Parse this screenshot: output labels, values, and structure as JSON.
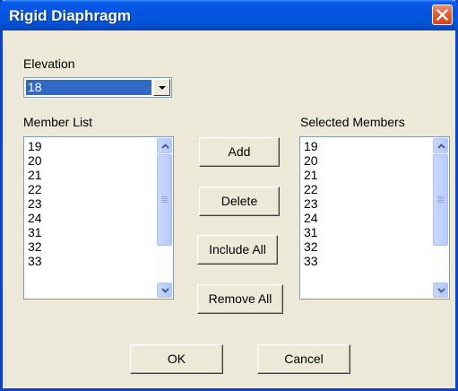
{
  "window": {
    "title": "Rigid Diaphragm"
  },
  "elevation": {
    "label": "Elevation",
    "selected_value": "18"
  },
  "member_list": {
    "label": "Member List",
    "items": [
      "19",
      "20",
      "21",
      "22",
      "23",
      "24",
      "31",
      "32",
      "33"
    ]
  },
  "selected_members": {
    "label": "Selected Members",
    "items": [
      "19",
      "20",
      "21",
      "22",
      "23",
      "24",
      "31",
      "32",
      "33"
    ]
  },
  "actions": {
    "add": "Add",
    "delete": "Delete",
    "include_all": "Include All",
    "remove_all": "Remove All"
  },
  "dialog_buttons": {
    "ok": "OK",
    "cancel": "Cancel"
  },
  "colors": {
    "titlebar": "#0553e0",
    "face": "#ece9d8",
    "selection": "#316ac5",
    "close": "#e65a35"
  },
  "icons": {
    "close": "close-icon",
    "dropdown": "chevron-down-icon",
    "scroll_up": "chevron-up-icon",
    "scroll_down": "chevron-down-icon"
  }
}
